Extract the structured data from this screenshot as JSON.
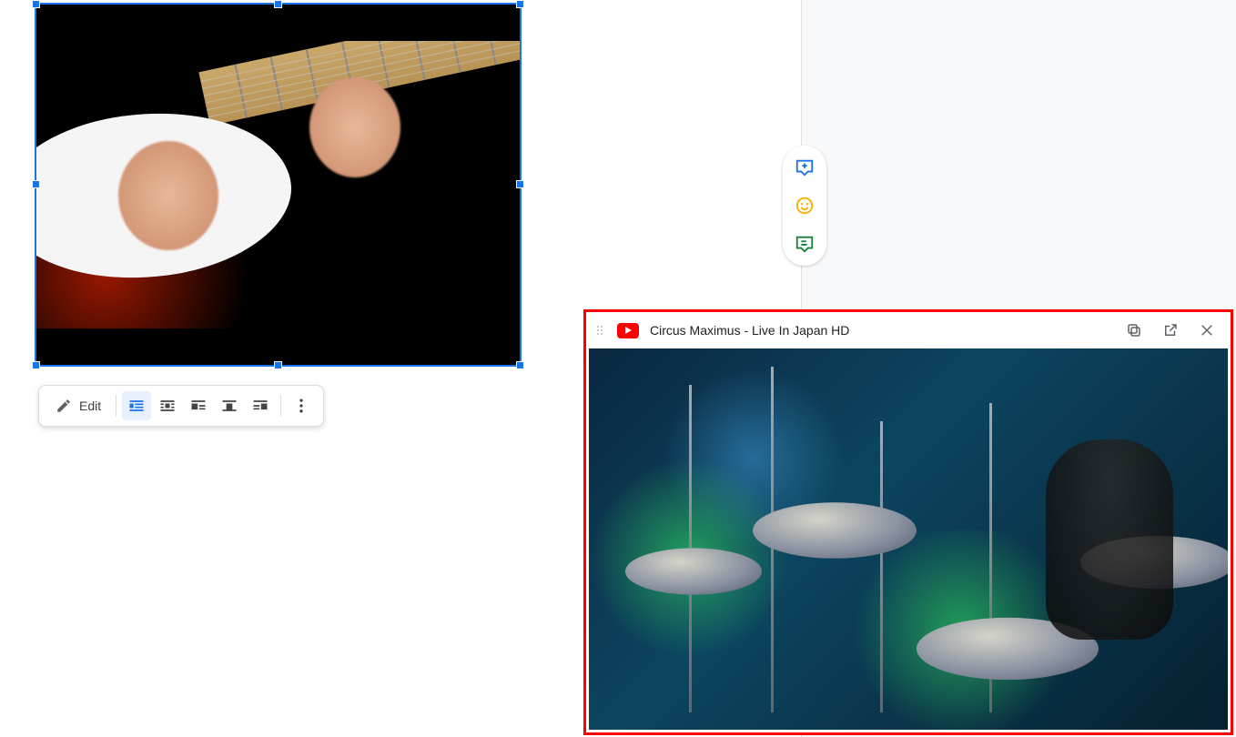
{
  "image_toolbar": {
    "edit_label": "Edit"
  },
  "pip_player": {
    "title": "Circus Maximus - Live In Japan HD"
  },
  "icons": {
    "pencil": "pencil-icon",
    "wrap_inline": "wrap-inline-icon",
    "wrap_break": "wrap-break-icon",
    "align_left": "align-left-icon",
    "align_center": "align-center-icon",
    "align_right": "align-right-icon",
    "more": "more-vert-icon",
    "add_comment": "add-comment-icon",
    "emoji": "emoji-icon",
    "suggest": "suggest-edit-icon",
    "copy": "copy-icon",
    "popout": "popout-icon",
    "close": "close-icon"
  }
}
